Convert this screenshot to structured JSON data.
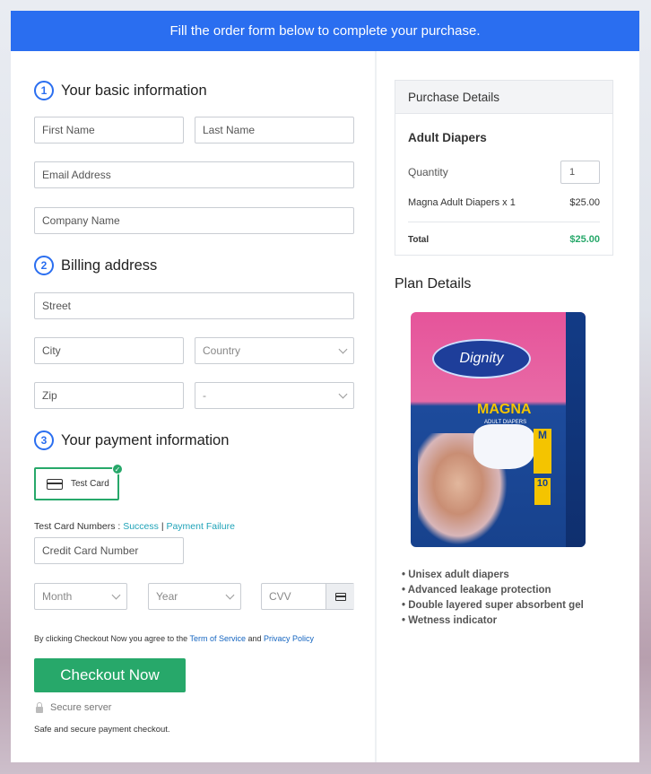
{
  "banner": "Fill the order form below to complete your purchase.",
  "sections": {
    "basic": {
      "number": "1",
      "title": "Your basic information"
    },
    "billing": {
      "number": "2",
      "title": "Billing address"
    },
    "payment": {
      "number": "3",
      "title": "Your payment information"
    }
  },
  "fields": {
    "first_name": "First Name",
    "last_name": "Last Name",
    "email": "Email Address",
    "company": "Company Name",
    "street": "Street",
    "city": "City",
    "country": "Country",
    "zip": "Zip",
    "state": "-",
    "credit_card": "Credit Card Number",
    "month": "Month",
    "year": "Year",
    "cvv": "CVV"
  },
  "payment": {
    "test_card_label": "Test Card",
    "test_numbers_label": "Test Card Numbers :",
    "success_link": "Success",
    "separator": "|",
    "failure_link": "Payment Failure"
  },
  "agreement": {
    "prefix": "By clicking Checkout Now you agree to the",
    "terms": "Term of Service",
    "and": "and",
    "privacy": "Privacy Policy"
  },
  "checkout_button": "Checkout Now",
  "secure_server": "Secure server",
  "secure_note": "Safe and secure payment checkout.",
  "purchase": {
    "header": "Purchase Details",
    "product": "Adult Diapers",
    "quantity_label": "Quantity",
    "quantity_value": "1",
    "item_label": "Magna Adult Diapers x 1",
    "item_price": "$25.00",
    "total_label": "Total",
    "total_value": "$25.00"
  },
  "plan": {
    "title": "Plan Details",
    "product_image": {
      "brand": "Dignity",
      "name": "MAGNA",
      "subtitle": "ADULT DIAPERS",
      "size": "M",
      "count": "10"
    },
    "features": [
      "Unisex adult diapers",
      "Advanced leakage protection",
      "Double layered super absorbent gel",
      "Wetness indicator"
    ]
  },
  "colors": {
    "banner": "#2a6ef0",
    "accent_green": "#27a86a",
    "link_teal": "#1fa3b8",
    "link_blue": "#1565c0"
  }
}
